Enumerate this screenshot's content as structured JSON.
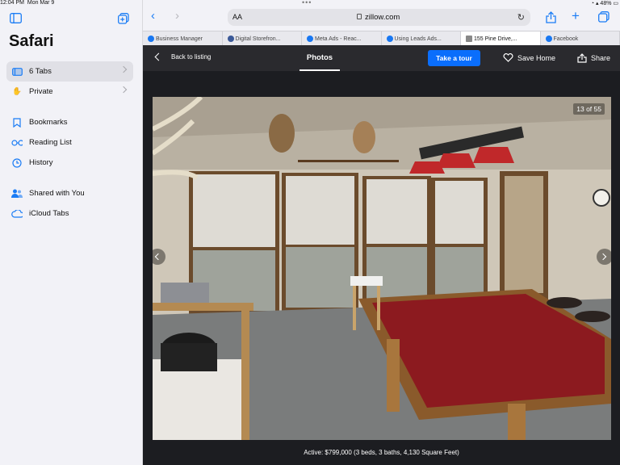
{
  "status": {
    "time": "12:04 PM",
    "date": "Mon Mar 9",
    "battery": "48%"
  },
  "sidebar": {
    "title": "Safari",
    "items": [
      {
        "label": "6 Tabs",
        "icon": "tabs-icon",
        "active": true,
        "chevron": true
      },
      {
        "label": "Private",
        "icon": "hand-icon",
        "active": false,
        "chevron": true
      },
      {
        "label": "Bookmarks",
        "icon": "bookmark-icon"
      },
      {
        "label": "Reading List",
        "icon": "glasses-icon"
      },
      {
        "label": "History",
        "icon": "clock-icon"
      },
      {
        "label": "Shared with You",
        "icon": "people-icon"
      },
      {
        "label": "iCloud Tabs",
        "icon": "cloud-icon"
      }
    ]
  },
  "browser": {
    "aa": "AA",
    "url": "zillow.com",
    "tabs": [
      {
        "label": "Business Manager",
        "color": "#1877f2"
      },
      {
        "label": "Digital Storefron...",
        "color": "#3b5998"
      },
      {
        "label": "Meta Ads - Reac...",
        "color": "#1877f2"
      },
      {
        "label": "Using Leads Ads...",
        "color": "#1877f2"
      },
      {
        "label": "155 Pine Drive,...",
        "color": "#0a6efc",
        "active": true
      },
      {
        "label": "Facebook",
        "color": "#1877f2"
      }
    ]
  },
  "zillow": {
    "back_label": "Back to listing",
    "photos_label": "Photos",
    "tour_label": "Take a tour",
    "save_label": "Save Home",
    "share_label": "Share",
    "counter": "13 of 55",
    "caption": "Active: $799,000 (3 beds, 3 baths, 4,130 Square Feet)",
    "accent": "#0a6efc"
  }
}
